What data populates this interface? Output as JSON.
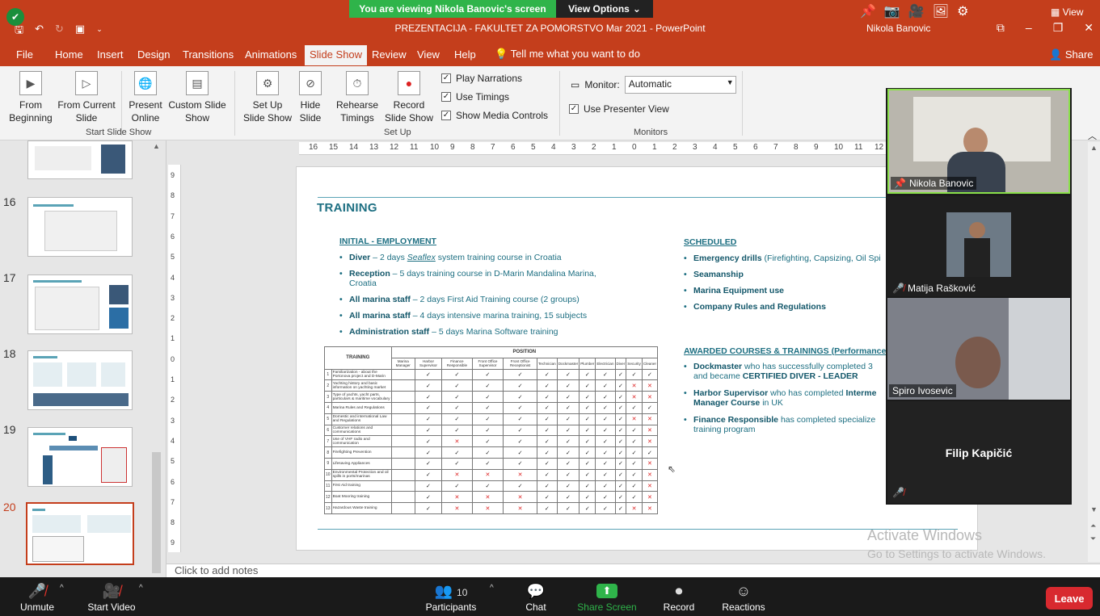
{
  "zoom": {
    "banner": "You are viewing Nikola Banovic's screen",
    "view_options": "View Options",
    "view_label": "View",
    "bottom": {
      "unmute": "Unmute",
      "start_video": "Start Video",
      "participants": "Participants",
      "participants_count": "10",
      "chat": "Chat",
      "share_screen": "Share Screen",
      "record": "Record",
      "reactions": "Reactions",
      "leave": "Leave"
    },
    "accent_green": "#2fb44a",
    "leave_red": "#d8292f"
  },
  "ppt": {
    "title": "PREZENTACIJA - FAKULTET ZA POMORSTVO Mar 2021  -  PowerPoint",
    "user": "Nikola Banovic",
    "brand_color": "#c43e1c",
    "menu": [
      "File",
      "Home",
      "Insert",
      "Design",
      "Transitions",
      "Animations",
      "Slide Show",
      "Review",
      "View",
      "Help"
    ],
    "tell_me": "Tell me what you want to do",
    "share": "Share",
    "ribbon": {
      "from_beginning": "From Beginning",
      "from_current": "From Current Slide",
      "present_online": "Present Online",
      "custom_show": "Custom Slide Show",
      "group_start": "Start Slide Show",
      "setup_show": "Set Up Slide Show",
      "hide_slide": "Hide Slide",
      "rehearse": "Rehearse Timings",
      "record_show": "Record Slide Show",
      "play_narrations": "Play Narrations",
      "use_timings": "Use Timings",
      "show_media": "Show Media Controls",
      "group_setup": "Set Up",
      "monitor_label": "Monitor:",
      "monitor_value": "Automatic",
      "presenter_view": "Use Presenter View",
      "group_monitors": "Monitors"
    },
    "thumbnails": [
      "16",
      "17",
      "18",
      "19",
      "20"
    ],
    "notes_placeholder": "Click to add notes",
    "hruler": [
      "16",
      "15",
      "14",
      "13",
      "12",
      "11",
      "10",
      "9",
      "8",
      "7",
      "6",
      "5",
      "4",
      "3",
      "2",
      "1",
      "0",
      "1",
      "2",
      "3",
      "4",
      "5",
      "6",
      "7",
      "8",
      "9",
      "10",
      "11",
      "12"
    ],
    "vruler": [
      "9",
      "8",
      "7",
      "6",
      "5",
      "4",
      "3",
      "2",
      "1",
      "0",
      "1",
      "2",
      "3",
      "4",
      "5",
      "6",
      "7",
      "8",
      "9"
    ]
  },
  "slide": {
    "title": "TRAINING",
    "initial_heading": "INITIAL - EMPLOYMENT",
    "initial": [
      {
        "b": "Diver",
        "pre": " – 2 days ",
        "i": "Seaflex",
        "t": " system training course in Croatia"
      },
      {
        "b": "Reception",
        "pre": "",
        "i": "",
        "t": " – 5 days training course in D-Marin Mandalina Marina, Croatia"
      },
      {
        "b": "All marina staff",
        "pre": "",
        "i": "",
        "t": " – 2 days First Aid Training course (2 groups)"
      },
      {
        "b": "All marina staff",
        "pre": "",
        "i": "",
        "t": " – 4 days intensive marina training, 15 subjects"
      },
      {
        "b": "Administration staff",
        "pre": "",
        "i": "",
        "t": " – 5 days Marina Software training"
      }
    ],
    "scheduled_heading": "SCHEDULED",
    "scheduled": [
      {
        "b": "Emergency drills",
        "t": " (Firefighting, Capsizing, Oil Spi"
      },
      {
        "b": "Seamanship",
        "t": ""
      },
      {
        "b": "Marina Equipment use",
        "t": ""
      },
      {
        "b": "Company Rules and Regulations",
        "t": ""
      }
    ],
    "awarded_heading": "AWARDED COURSES & TRAININGS (Performance re",
    "awarded": [
      {
        "b": "Dockmaster",
        "t": " who has successfully completed 3",
        "t2": "and became ",
        "b2": "CERTIFIED DIVER - LEADER"
      },
      {
        "b": "Harbor Supervisor",
        "t": " who has completed ",
        "b3": "Interme",
        "b2": "Manager Course",
        "t2": " in UK"
      },
      {
        "b": "Finance Responsible",
        "t": " has completed specialize",
        "t2": "training program"
      }
    ],
    "table": {
      "head_training": "TRAINING",
      "head_position": "POSITION",
      "positions": [
        "Marina Manager",
        "Harbor Supervisor",
        "Finance Responsible",
        "Front Office Supervisor",
        "Front Office Receptionist",
        "Technician",
        "Dockmaster",
        "Plumber",
        "Electrician",
        "Diver",
        "Security",
        "Cleaner"
      ],
      "rows": [
        {
          "n": "1",
          "name": "Familiarization - about the Portonova project and D-Marin",
          "v": "-vvvvvvvvvvv"
        },
        {
          "n": "2",
          "name": "Yachting history and basic information on yachting market",
          "v": "-vvvvvvvvvxx"
        },
        {
          "n": "3",
          "name": "Type of yachts, yacht parts, particulars & maritime vocabulary",
          "v": "-vvvvvvvvvxx"
        },
        {
          "n": "4",
          "name": "Marina Rules and Regulations",
          "v": "-vvvvvvvvvvv"
        },
        {
          "n": "5",
          "name": "Domestic and international Law and Regulations",
          "v": "-vvvvvvvvvxx"
        },
        {
          "n": "6",
          "name": "Customer relations and communications",
          "v": "-vvvvvvvvvvx"
        },
        {
          "n": "7",
          "name": "Use of VHF radio and communication",
          "v": "-vxvvvvvvvvx"
        },
        {
          "n": "8",
          "name": "Firefighting Prevention",
          "v": "-vvvvvvvvvvv"
        },
        {
          "n": "9",
          "name": "Lifesaving Appliances",
          "v": "-vvvvvvvvvvx"
        },
        {
          "n": "10",
          "name": "Environmental Protection and oil spills in ports/marinas",
          "v": "-vxxxvvvvvvx"
        },
        {
          "n": "11",
          "name": "First Aid training",
          "v": "-vvvvvvvvvvx"
        },
        {
          "n": "12",
          "name": "Boat Mooring training",
          "v": "-vxxxvvvvvvx"
        },
        {
          "n": "13",
          "name": "Hazardous Waste training",
          "v": "-vxxxvvvvvxx"
        }
      ]
    }
  },
  "participants": [
    {
      "name": "Nikola Banovic"
    },
    {
      "name": "Matija Rašković"
    },
    {
      "name": "Spiro Ivosevic"
    },
    {
      "name": "Filip Kapičić"
    }
  ],
  "watermark": {
    "line1": "Activate Windows",
    "line2": "Go to Settings to activate Windows."
  }
}
